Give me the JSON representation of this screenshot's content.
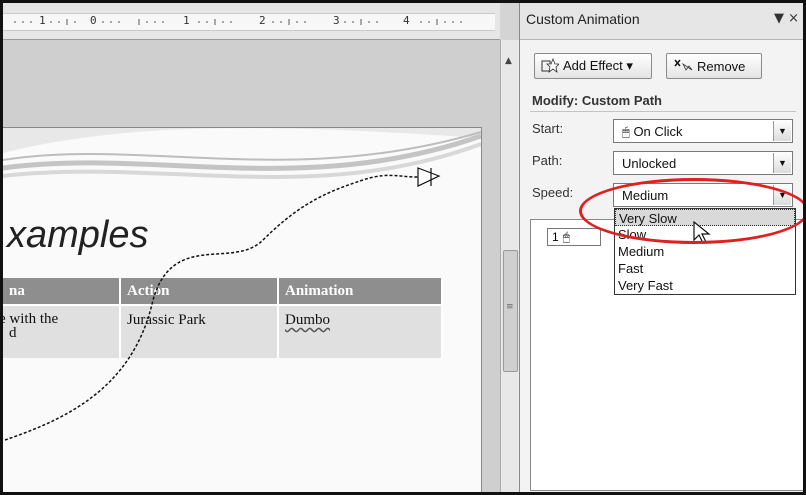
{
  "ruler": {
    "marks": [
      "1",
      "0",
      "1",
      "2",
      "3",
      "4"
    ]
  },
  "slide": {
    "title": "xamples",
    "table": {
      "headers": [
        "na",
        "Action",
        "Animation"
      ],
      "rows": [
        [
          "e with the\nd",
          "Jurassic Park",
          "Dumbo"
        ]
      ]
    }
  },
  "pane": {
    "title": "Custom Animation",
    "controls": "▼ ×",
    "add_effect_label": "Add Effect ▾",
    "remove_label": "Remove",
    "section_title": "Modify: Custom Path",
    "start_label": "Start:",
    "start_value": "On Click",
    "path_label": "Path:",
    "path_value": "Unlocked",
    "speed_label": "Speed:",
    "speed_value": "Medium",
    "list_item_number": "1"
  },
  "speed_dropdown": {
    "options": [
      "Very Slow",
      "Slow",
      "Medium",
      "Fast",
      "Very Fast"
    ],
    "highlighted": "Very Slow"
  },
  "colors": {
    "callout": "#e02020",
    "table_header": "#8e8e8e"
  }
}
